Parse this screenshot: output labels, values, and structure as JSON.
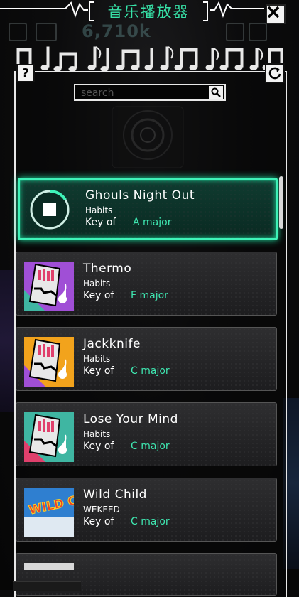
{
  "header": {
    "title": "音乐播放器",
    "close_icon": "close-icon"
  },
  "hud": {
    "score": "6,710k"
  },
  "search": {
    "placeholder": "search",
    "value": ""
  },
  "buttons": {
    "help": "?",
    "refresh_icon": "refresh-icon"
  },
  "songs": [
    {
      "title": "Ghouls Night Out",
      "artist": "Habits",
      "key_label": "Key of",
      "key": "A major",
      "playing": true
    },
    {
      "title": "Thermo",
      "artist": "Habits",
      "key_label": "Key of",
      "key": "F major",
      "playing": false,
      "cover_color": "#a04fd6"
    },
    {
      "title": "Jackknife",
      "artist": "Habits",
      "key_label": "Key of",
      "key": "C major",
      "playing": false,
      "cover_color": "#f2a31c"
    },
    {
      "title": "Lose Your Mind",
      "artist": "Habits",
      "key_label": "Key of",
      "key": "C major",
      "playing": false,
      "cover_color": "#3fb6a2"
    },
    {
      "title": "Wild Child",
      "artist": "WEKEED",
      "key_label": "Key of",
      "key": "C major",
      "playing": false,
      "cover_text": "WILD CHILD"
    }
  ],
  "colors": {
    "accent": "#3ee6b0",
    "panel_border": "#e8e8e8"
  }
}
